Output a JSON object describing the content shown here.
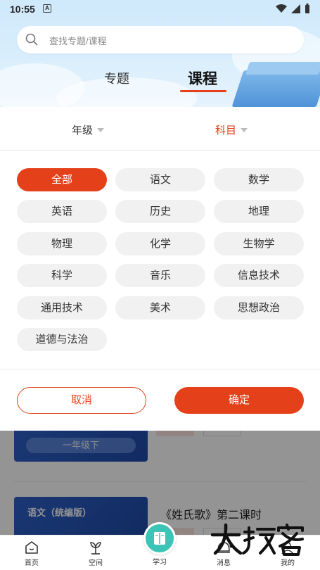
{
  "status_bar": {
    "time": "10:55",
    "notif_glyph": "A"
  },
  "search": {
    "placeholder": "查找专题/课程"
  },
  "tabs": [
    {
      "label": "专题",
      "active": false
    },
    {
      "label": "课程",
      "active": true
    }
  ],
  "filters": {
    "grade": "年级",
    "subject": "科目"
  },
  "subjects": [
    "全部",
    "语文",
    "数学",
    "英语",
    "历史",
    "地理",
    "物理",
    "化学",
    "生物学",
    "科学",
    "音乐",
    "信息技术",
    "通用技术",
    "美术",
    "思想政治",
    "道德与法治"
  ],
  "selected_subject": "全部",
  "actions": {
    "cancel": "取消",
    "confirm": "确定"
  },
  "courses": [
    {
      "grade_label": "一年级下"
    },
    {
      "card_title": "语文（统编版）",
      "title": "《姓氏歌》第二课时"
    }
  ],
  "bottom_nav": [
    {
      "label": "首页",
      "icon": "home-icon"
    },
    {
      "label": "空间",
      "icon": "sprout-icon"
    },
    {
      "label": "学习",
      "icon": "book-icon"
    },
    {
      "label": "消息",
      "icon": "message-icon"
    },
    {
      "label": "我的",
      "icon": "profile-icon"
    }
  ],
  "watermark": "大玩客",
  "colors": {
    "accent": "#e4411b",
    "study_button": "#3cc4b6",
    "header_bg": "#d9eefc"
  }
}
